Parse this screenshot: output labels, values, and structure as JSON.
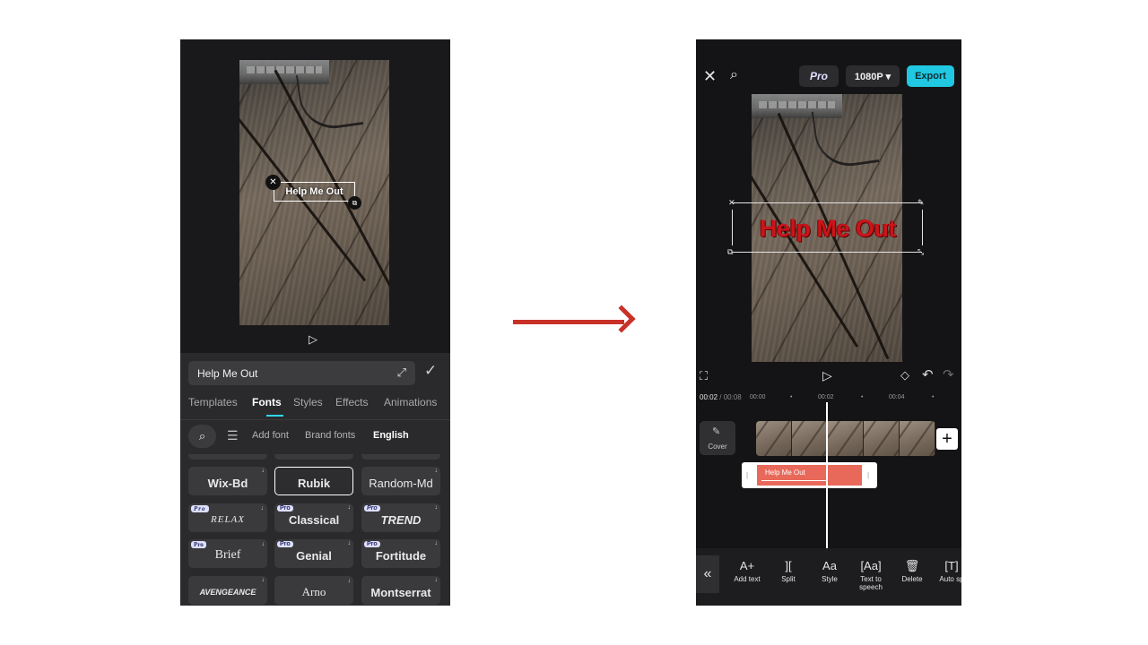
{
  "left": {
    "overlay_text": "Help Me Out",
    "text_field_value": "Help Me Out",
    "tabs": [
      "Templates",
      "Fonts",
      "Styles",
      "Effects",
      "Animations"
    ],
    "font_tools": [
      "Add font",
      "Brand fonts",
      "English"
    ],
    "pro_label": "Pro",
    "fonts": [
      {
        "name": "Wix-Bd",
        "pro": false
      },
      {
        "name": "Rubik",
        "pro": false,
        "selected": true
      },
      {
        "name": "Random-Md",
        "pro": false
      },
      {
        "name": "RELAX",
        "pro": true
      },
      {
        "name": "Classical",
        "pro": true
      },
      {
        "name": "TREND",
        "pro": true
      },
      {
        "name": "Brief",
        "pro": true
      },
      {
        "name": "Genial",
        "pro": true
      },
      {
        "name": "Fortitude",
        "pro": true
      },
      {
        "name": "AVENGEANCE",
        "pro": false
      },
      {
        "name": "Arno",
        "pro": false
      },
      {
        "name": "Montserrat",
        "pro": false
      }
    ],
    "icons": [
      "close-icon",
      "resize-icon",
      "play-icon",
      "expand-icon",
      "check-icon",
      "search-icon",
      "filter-icon",
      "download-icon"
    ]
  },
  "right": {
    "pro_badge": "Pro",
    "resolution": "1080P ▾",
    "export_label": "Export",
    "overlay_text": "Help Me Out",
    "current_time": "00:02",
    "total_time": " / 00:08",
    "ticks": [
      "00:00",
      "00:02",
      "00:04"
    ],
    "cover_label": "Cover",
    "text_clip_label": "Help Me Out",
    "tools": [
      {
        "icon": "A+",
        "label": "Add text"
      },
      {
        "icon": "][",
        "label": "Split"
      },
      {
        "icon": "Aa",
        "label": "Style"
      },
      {
        "icon": "[Aa]",
        "label": "Text to speech"
      },
      {
        "icon": "🗑",
        "label": "Delete"
      },
      {
        "icon": "[T]",
        "label": "Auto sp"
      }
    ],
    "icons": [
      "close-icon",
      "search-icon",
      "fullscreen-icon",
      "play-icon",
      "keyframe-icon",
      "undo-icon",
      "redo-icon",
      "collapse-icon",
      "add-clip-icon"
    ]
  }
}
